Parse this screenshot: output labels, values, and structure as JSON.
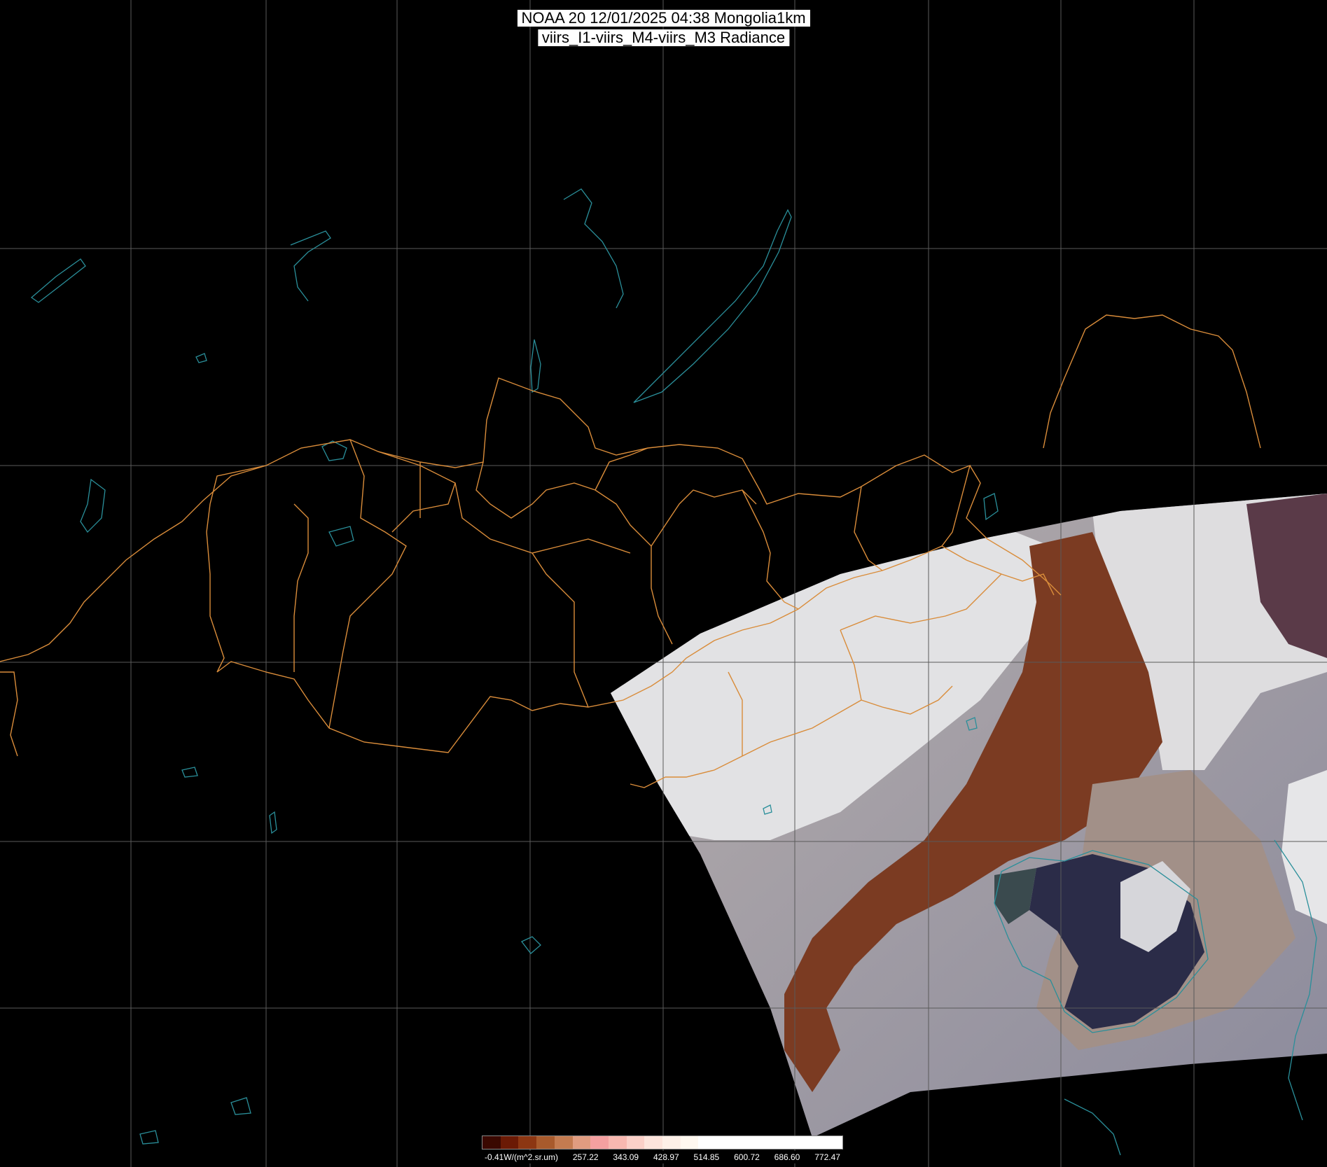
{
  "title": {
    "line1": "NOAA 20 12/01/2025 04:38 Mongolia1km",
    "line2": "viirs_I1-viirs_M4-viirs_M3 Radiance"
  },
  "colorbar": {
    "unit_label": "-0.41W/(m^2.sr.um)",
    "ticks": [
      "257.22",
      "343.09",
      "428.97",
      "514.85",
      "600.72",
      "686.60",
      "772.47"
    ],
    "colors": [
      "#3a0800",
      "#6b1a05",
      "#8c3612",
      "#a85a2c",
      "#c47b50",
      "#e09c80",
      "#f4a0a0",
      "#f8b8b0",
      "#fbd0c8",
      "#fde4dc",
      "#fef0e8",
      "#fff8f0",
      "#ffffff",
      "#ffffff",
      "#ffffff",
      "#ffffff",
      "#ffffff",
      "#ffffff",
      "#ffffff",
      "#ffffff"
    ]
  },
  "map": {
    "background_color": "#000000",
    "grid_color": "#5a5a5a",
    "border_color": "#d98c3a",
    "coast_color": "#2a8f9a",
    "swath_colors": {
      "cloud": "#dcdcdc",
      "desert": "#7a3a22",
      "plain": "#a79a92",
      "sea": "#2e2f4a",
      "haze": "#8f9a8a"
    }
  }
}
